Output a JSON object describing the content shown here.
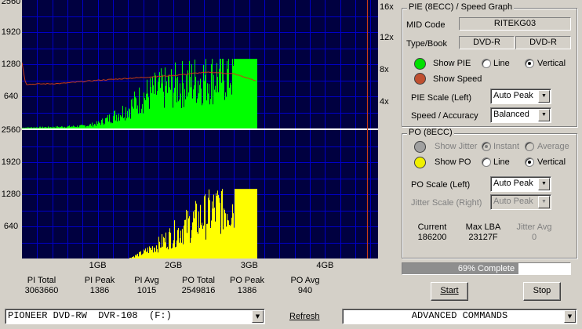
{
  "graph": {
    "pie_y_ticks": [
      "2560",
      "1920",
      "1280",
      "640"
    ],
    "po_y_ticks": [
      "2560",
      "1920",
      "1280",
      "640"
    ],
    "speed_ticks": [
      "16x",
      "12x",
      "8x",
      "4x"
    ],
    "x_ticks": [
      "1GB",
      "2GB",
      "3GB",
      "4GB"
    ],
    "colors": {
      "background": "#000040",
      "grid": "#0000c8",
      "pie_fill": "#00ff00",
      "speed_line": "#c83c14",
      "po_fill": "#ffff00",
      "divider": "#ffffff",
      "end_marker": "#c83c14"
    }
  },
  "chart_data": [
    {
      "type": "area",
      "name_hint": "PIE (8ECC)",
      "x_unit": "GB",
      "xlim": [
        0,
        4.7
      ],
      "ylim": [
        0,
        2560
      ],
      "series": [
        {
          "x": [
            0,
            0.5,
            0.8,
            1.0,
            1.2,
            1.4,
            1.6,
            1.8,
            2.0,
            2.2,
            2.4,
            2.6,
            2.8,
            3.0,
            3.1
          ],
          "values": [
            20,
            40,
            60,
            120,
            300,
            500,
            800,
            950,
            1050,
            1150,
            1250,
            1300,
            1386,
            1386,
            1386
          ]
        }
      ],
      "speed_axis": {
        "ylim": [
          0,
          16
        ],
        "x": [
          0,
          0.05,
          0.5,
          1.0,
          1.5,
          2.0,
          2.3,
          2.5,
          2.8,
          3.0,
          3.1
        ],
        "values": [
          8.2,
          5.5,
          5.6,
          6.0,
          6.3,
          6.6,
          6.9,
          7.0,
          6.8,
          6.2,
          5.9
        ]
      }
    },
    {
      "type": "area",
      "name_hint": "PO (8ECC)",
      "x_unit": "GB",
      "xlim": [
        0,
        4.7
      ],
      "ylim": [
        0,
        2560
      ],
      "series": [
        {
          "x": [
            0,
            1.4,
            1.6,
            1.8,
            2.0,
            2.2,
            2.4,
            2.6,
            2.8,
            3.0,
            3.1
          ],
          "values": [
            0,
            0,
            150,
            350,
            600,
            850,
            1050,
            1250,
            1386,
            1386,
            1386
          ]
        }
      ]
    }
  ],
  "stats": {
    "pi_total": {
      "label": "PI Total",
      "value": "3063660"
    },
    "pi_peak": {
      "label": "PI Peak",
      "value": "1386"
    },
    "pi_avg": {
      "label": "PI Avg",
      "value": "1015"
    },
    "po_total": {
      "label": "PO Total",
      "value": "2549816"
    },
    "po_peak": {
      "label": "PO Peak",
      "value": "1386"
    },
    "po_avg": {
      "label": "PO Avg",
      "value": "940"
    }
  },
  "pie_group": {
    "title": "PIE (8ECC) / Speed Graph",
    "mid_code_label": "MID Code",
    "mid_code_value": "RITEKG03",
    "type_book_label": "Type/Book",
    "type_value": "DVD-R",
    "book_value": "DVD-R",
    "show_pie_label": "Show PIE",
    "show_speed_label": "Show Speed",
    "line_label": "Line",
    "vertical_label": "Vertical",
    "style_selected": "Vertical",
    "pie_scale_label": "PIE Scale (Left)",
    "pie_scale_value": "Auto Peak",
    "speed_accuracy_label": "Speed / Accuracy",
    "speed_accuracy_value": "Balanced",
    "pie_color": "#00e000",
    "speed_color": "#c05030"
  },
  "po_group": {
    "title": "PO (8ECC)",
    "show_jitter_label": "Show Jitter",
    "instant_label": "Instant",
    "average_label": "Average",
    "show_po_label": "Show PO",
    "line_label": "Line",
    "vertical_label": "Vertical",
    "style_selected": "Vertical",
    "po_scale_label": "PO Scale (Left)",
    "po_scale_value": "Auto Peak",
    "jitter_scale_label": "Jitter Scale (Right)",
    "jitter_scale_value": "Auto Peak",
    "current_label": "Current",
    "current_value": "186200",
    "max_lba_label": "Max LBA",
    "max_lba_value": "23127F",
    "jitter_avg_label": "Jitter Avg",
    "jitter_avg_value": "0",
    "po_color": "#f0f000",
    "jitter_color": "#a0a0a0"
  },
  "progress": {
    "percent": 69,
    "text": "69% Complete"
  },
  "buttons": {
    "start": "Start",
    "stop": "Stop",
    "refresh": "Refresh"
  },
  "drive_select": {
    "value": "PIONEER DVD-RW  DVR-108  (F:)"
  },
  "commands_select": {
    "value": "ADVANCED COMMANDS"
  }
}
